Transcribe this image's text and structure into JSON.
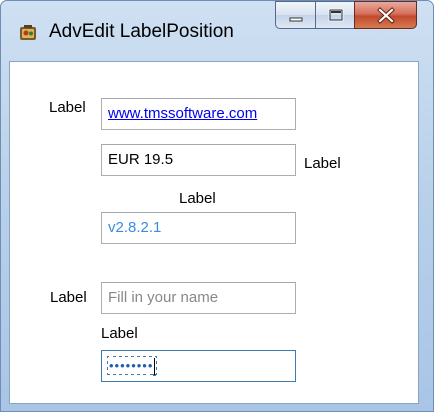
{
  "window": {
    "title": "AdvEdit LabelPosition",
    "app_icon": "app-icon"
  },
  "caption_buttons": {
    "minimize_icon": "minimize-icon",
    "maximize_icon": "maximize-icon",
    "close_icon": "close-icon"
  },
  "form": {
    "url_edit": {
      "label": "Label",
      "value": "www.tmssoftware.com"
    },
    "currency_edit": {
      "label": "Label",
      "value": "EUR 19.5"
    },
    "version_edit": {
      "label": "Label",
      "value": "v2.8.2.1"
    },
    "name_edit": {
      "label": "Label",
      "placeholder": "Fill in your name",
      "value": ""
    },
    "password_edit": {
      "label": "Label",
      "masked_value": "••••••••"
    }
  },
  "colors": {
    "link": "#0000ee",
    "version_text": "#3c8be0",
    "placeholder": "#888888",
    "focus_border": "#3d7bad"
  }
}
